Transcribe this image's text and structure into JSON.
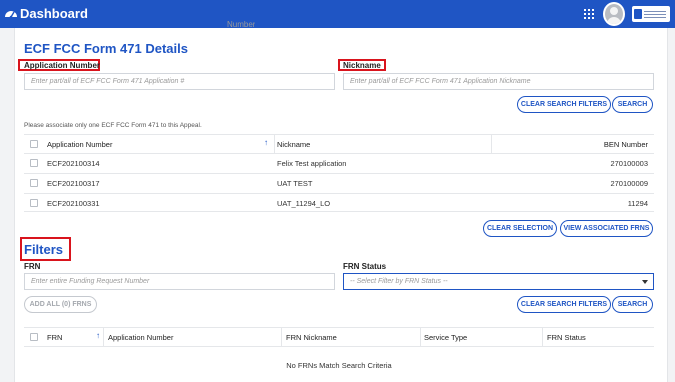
{
  "header": {
    "title": "Dashboard",
    "icons": [
      "dashboard-icon",
      "apps-grid-icon",
      "user-avatar",
      "usac-logo"
    ]
  },
  "ghost_label": "Number",
  "ecf_section": {
    "title": "ECF FCC Form 471 Details",
    "app_number_label": "Application Number",
    "app_number_placeholder": "Enter part/all of ECF FCC Form 471 Application #",
    "nickname_label": "Nickname",
    "nickname_placeholder": "Enter part/all of ECF FCC Form 471 Application Nickname",
    "clear_filters_label": "CLEAR SEARCH FILTERS",
    "search_label": "SEARCH",
    "note": "Please associate only one ECF FCC Form 471 to this Appeal.",
    "table": {
      "headers": [
        "Application Number",
        "Nickname",
        "BEN Number"
      ],
      "rows": [
        [
          "ECF202100314",
          "Felix Test application",
          "270100003"
        ],
        [
          "ECF202100317",
          "UAT TEST",
          "270100009"
        ],
        [
          "ECF202100331",
          "UAT_11294_LO",
          "11294"
        ]
      ]
    },
    "clear_selection_label": "CLEAR SELECTION",
    "view_frns_label": "VIEW ASSOCIATED FRNS"
  },
  "filters": {
    "title": "Filters",
    "frn_label": "FRN",
    "frn_placeholder": "Enter entire Funding Request Number",
    "frn_status_label": "FRN Status",
    "frn_status_value": "-- Select Filter by FRN Status --",
    "add_all_label": "ADD ALL (0) FRNS",
    "clear_filters_label": "CLEAR SEARCH FILTERS",
    "search_label": "SEARCH",
    "table": {
      "headers": [
        "FRN",
        "Application Number",
        "FRN Nickname",
        "Service Type",
        "FRN Status"
      ],
      "empty_message": "No FRNs Match Search Criteria"
    }
  },
  "colors": {
    "brand": "#1f55c4",
    "highlight": "#d9141d"
  }
}
